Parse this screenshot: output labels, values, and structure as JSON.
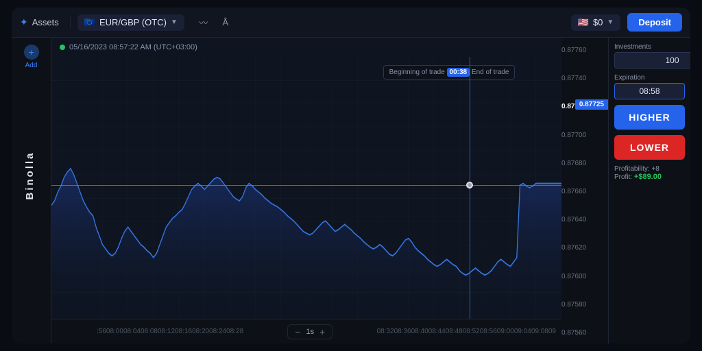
{
  "app": {
    "title": "Binolla"
  },
  "topbar": {
    "assets_label": "Assets",
    "pair_label": "EUR/GBP (OTC)",
    "deposit_label": "Deposit",
    "balance": "$0"
  },
  "chart": {
    "datetime": "05/16/2023  08:57:22 AM (UTC+03:00)",
    "trade_annotation": "Beginning of trade",
    "trade_time_badge": "00:38",
    "trade_annotation_end": "End of trade",
    "current_price": "0.87725",
    "zoom_level": "1s",
    "price_labels": [
      "0.87760",
      "0.87740",
      "0.87720",
      "0.87700",
      "0.87680",
      "0.87660",
      "0.87640",
      "0.87620",
      "0.87600",
      "0.87580",
      "0.87560"
    ],
    "time_labels": [
      ":56",
      "08:00",
      "08:04",
      "08:08",
      "08:12",
      "08:16",
      "08:20",
      "08:24",
      "08:28",
      "08:32",
      "08:36",
      "08:40",
      "08:44",
      "08:48",
      "08:52",
      "08:56",
      "09:00",
      "09:04",
      "09:08",
      "09"
    ]
  },
  "right_panel": {
    "investments_label": "Investments",
    "investment_value": "100",
    "currency": "$",
    "expiration_label": "Expiration",
    "expiration_value": "08:58",
    "higher_label": "HIGHER",
    "lower_label": "LOWER",
    "profitability_label": "Profitability: +8",
    "profit_label": "Profit:",
    "profit_value": "+$89.00"
  },
  "sidebar": {
    "add_label": "Add"
  }
}
